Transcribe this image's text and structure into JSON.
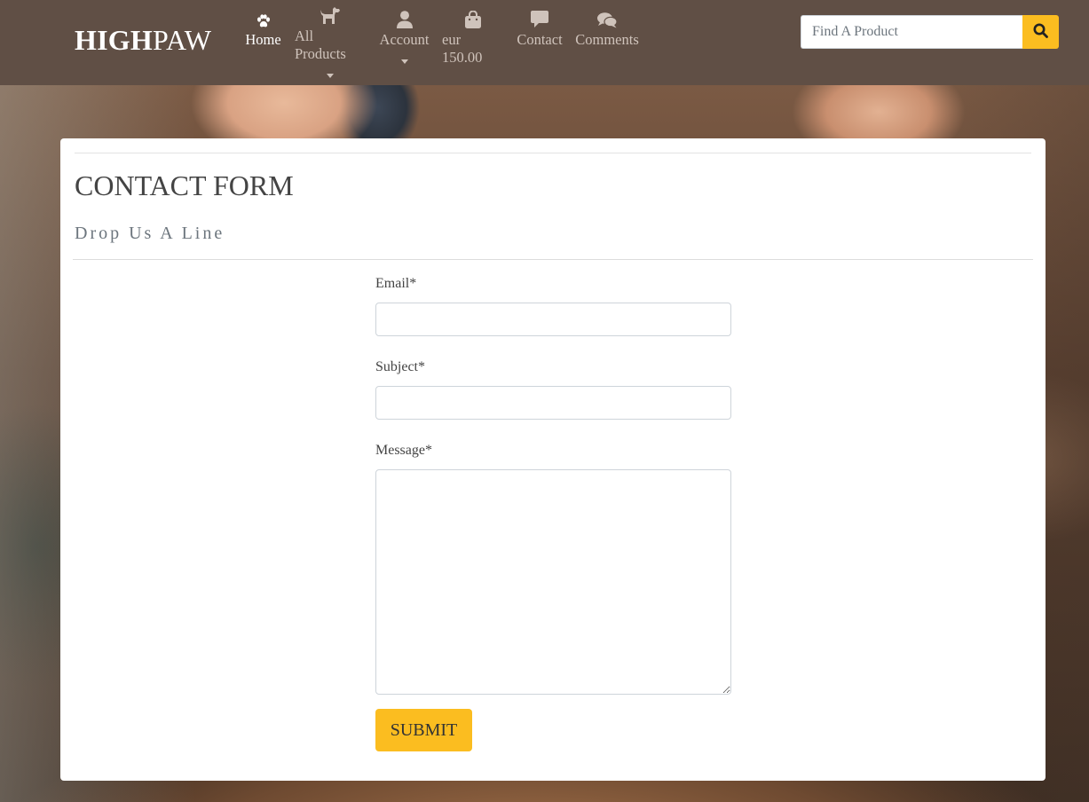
{
  "brand": {
    "bold": "HIGH",
    "light": "PAW"
  },
  "nav": {
    "items": [
      {
        "label": "Home",
        "icon": "paw-icon",
        "active": true
      },
      {
        "label": "All Products",
        "icon": "dog-icon",
        "dropdown": true
      },
      {
        "label": "Account",
        "icon": "user-icon",
        "dropdown": true
      },
      {
        "label": "eur 150.00",
        "icon": "shopping-bag-icon"
      },
      {
        "label": "Contact",
        "icon": "comment-icon"
      },
      {
        "label": "Comments",
        "icon": "comments-icon"
      }
    ]
  },
  "search": {
    "placeholder": "Find A Product",
    "icon": "search-icon"
  },
  "contact": {
    "title": "CONTACT FORM",
    "subtitle": "Drop Us A Line",
    "email_label": "Email*",
    "subject_label": "Subject*",
    "message_label": "Message*",
    "submit_label": "SUBMIT"
  },
  "colors": {
    "navbar": "#604f45",
    "accent": "#fbbd20",
    "nav_text": "#cfc3bb",
    "active_text": "#ffffff"
  }
}
